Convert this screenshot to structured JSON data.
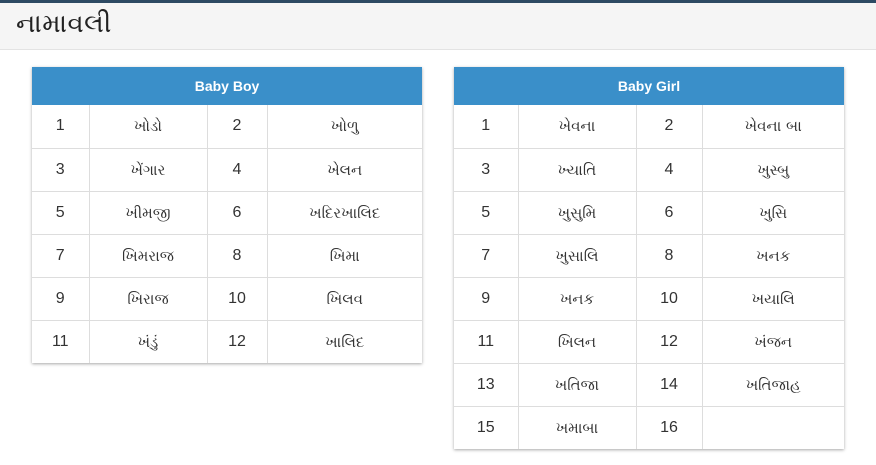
{
  "page": {
    "title": "નામાવલી"
  },
  "colors": {
    "panel_header": "#3a8fc9",
    "top_bar": "#2d4a63"
  },
  "boy": {
    "title": "Baby Boy",
    "rows": [
      [
        {
          "n": "1",
          "name": "ખોડો"
        },
        {
          "n": "2",
          "name": "ખોળુ"
        }
      ],
      [
        {
          "n": "3",
          "name": "ખેંગાર"
        },
        {
          "n": "4",
          "name": "ખેલન"
        }
      ],
      [
        {
          "n": "5",
          "name": "ખીમજી"
        },
        {
          "n": "6",
          "name": "ખદિરખાલિદ"
        }
      ],
      [
        {
          "n": "7",
          "name": "ખિમરાજ"
        },
        {
          "n": "8",
          "name": "ખિમા"
        }
      ],
      [
        {
          "n": "9",
          "name": "ખિરાજ"
        },
        {
          "n": "10",
          "name": "ખિલવ"
        }
      ],
      [
        {
          "n": "11",
          "name": "ખંડું"
        },
        {
          "n": "12",
          "name": "ખાલિદ"
        }
      ]
    ]
  },
  "girl": {
    "title": "Baby Girl",
    "rows": [
      [
        {
          "n": "1",
          "name": "ખેવના"
        },
        {
          "n": "2",
          "name": "ખેવના બા"
        }
      ],
      [
        {
          "n": "3",
          "name": "ખ્યાતિ"
        },
        {
          "n": "4",
          "name": "ખુસ્બુ"
        }
      ],
      [
        {
          "n": "5",
          "name": "ખુસુમિ"
        },
        {
          "n": "6",
          "name": "ખુસિ"
        }
      ],
      [
        {
          "n": "7",
          "name": "ખુસાલિ"
        },
        {
          "n": "8",
          "name": "ખનક"
        }
      ],
      [
        {
          "n": "9",
          "name": "ખનક"
        },
        {
          "n": "10",
          "name": "ખયાલિ"
        }
      ],
      [
        {
          "n": "11",
          "name": "ખિલન"
        },
        {
          "n": "12",
          "name": "ખંજન"
        }
      ],
      [
        {
          "n": "13",
          "name": "ખતિજા"
        },
        {
          "n": "14",
          "name": "ખતિજાહ"
        }
      ],
      [
        {
          "n": "15",
          "name": "ખમાબા"
        },
        {
          "n": "16",
          "name": ""
        }
      ]
    ]
  }
}
